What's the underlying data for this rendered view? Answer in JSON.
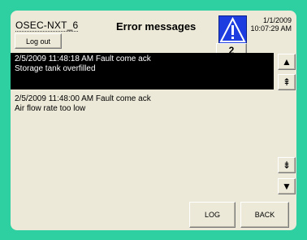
{
  "header": {
    "station": "OSEC-NXT_6",
    "logout_label": "Log out",
    "title": "Error messages",
    "alarm_count": "2",
    "date": "1/1/2009",
    "time": "10:07:29 AM"
  },
  "alarms": [
    {
      "meta": "2/5/2009 11:48:18 AM Fault  come  ack",
      "text": "Storage tank overfilled",
      "selected": true
    },
    {
      "meta": "2/5/2009 11:48:00 AM Fault  come  ack",
      "text": "Air flow rate too low",
      "selected": false
    }
  ],
  "scroll": {
    "up": "▲",
    "page_up": "⇞",
    "page_down": "⇟",
    "down": "▼"
  },
  "footer": {
    "log_label": "LOG",
    "back_label": "BACK"
  },
  "colors": {
    "background": "#2ecfa0",
    "panel": "#ece9d8",
    "warning_icon": "#1e3de0",
    "selected_row": "#000000"
  }
}
